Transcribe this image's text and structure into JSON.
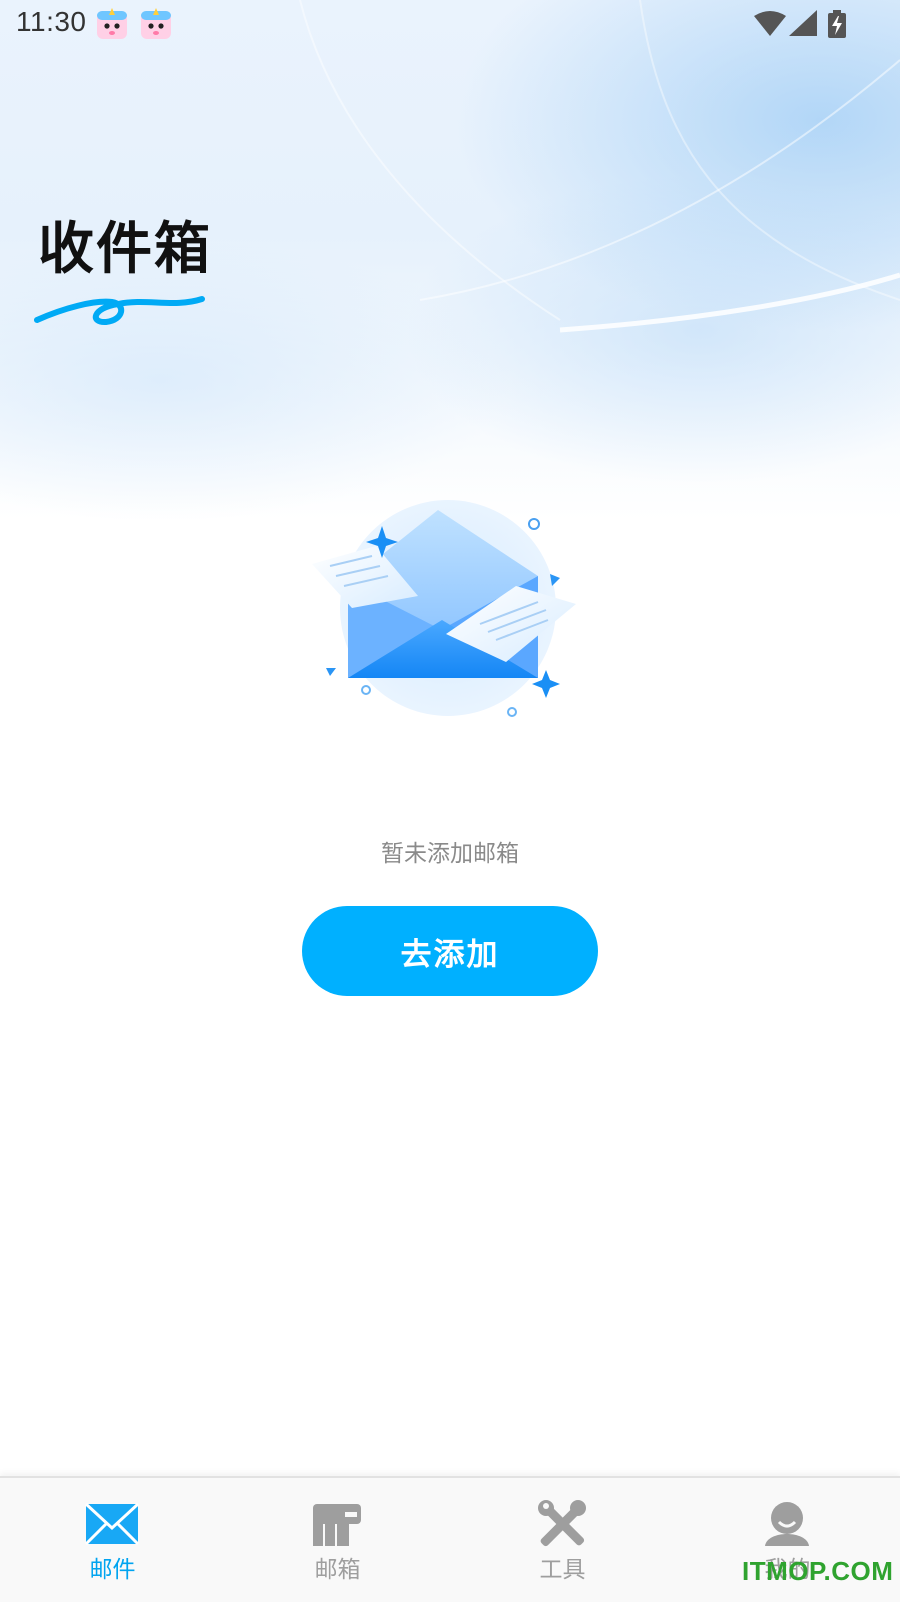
{
  "status_bar": {
    "time": "11:30",
    "notification_icons": [
      "unicorn-app-icon",
      "unicorn-app-icon"
    ],
    "system_icons": [
      "wifi-icon",
      "cell-signal-icon",
      "battery-charging-icon"
    ]
  },
  "header": {
    "title": "收件箱"
  },
  "empty_state": {
    "illustration": "open-envelope-illustration",
    "message": "暂未添加邮箱",
    "action_label": "去添加"
  },
  "bottom_nav": {
    "items": [
      {
        "label": "邮件",
        "icon": "mail-icon",
        "active": true
      },
      {
        "label": "邮箱",
        "icon": "mailbox-icon",
        "active": false
      },
      {
        "label": "工具",
        "icon": "tools-icon",
        "active": false
      },
      {
        "label": "我的",
        "icon": "profile-icon",
        "active": false
      }
    ]
  },
  "watermark": "ITMOP.COM",
  "colors": {
    "accent": "#00b0ff",
    "nav_active": "#00a4f0",
    "nav_inactive": "#9e9e9e",
    "title": "#111111",
    "muted_text": "#8a8a8a"
  }
}
